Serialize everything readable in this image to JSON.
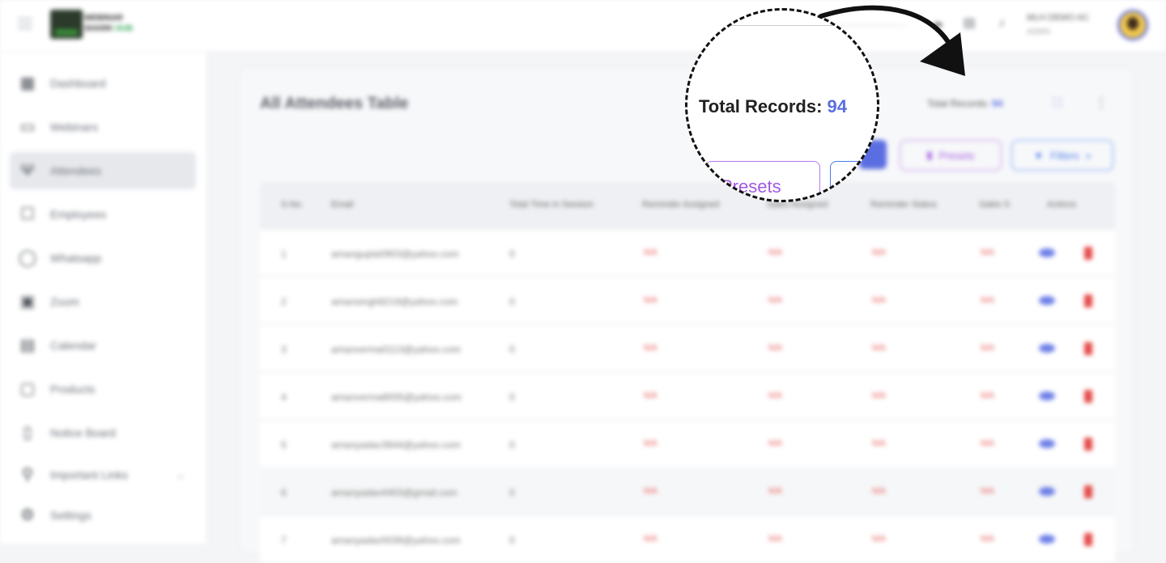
{
  "header": {
    "logo_line1": "WEBINAR",
    "logo_line2a": "SHARK",
    "logo_line2b": "HUB",
    "user_name": "MLH DEMO AC",
    "user_role": "ADMIN"
  },
  "sidebar": {
    "items": [
      {
        "label": "Dashboard",
        "icon": "▦"
      },
      {
        "label": "Webinars",
        "icon": "▭"
      },
      {
        "label": "Attendees",
        "icon": "Ψ"
      },
      {
        "label": "Employees",
        "icon": "☐"
      },
      {
        "label": "Whatsapp",
        "icon": "◯"
      },
      {
        "label": "Zoom",
        "icon": "▣"
      },
      {
        "label": "Calendar",
        "icon": "▤"
      },
      {
        "label": "Products",
        "icon": "▢"
      },
      {
        "label": "Notice Board",
        "icon": "▯"
      },
      {
        "label": "Important Links",
        "icon": "⚲"
      },
      {
        "label": "Settings",
        "icon": "⚙"
      }
    ],
    "chevron": "⌄"
  },
  "main": {
    "title": "All Attendees Table",
    "total_records_label": "Total Records:",
    "total_records_value": "94",
    "presets_label": "Presets",
    "filters_label": "Filters",
    "columns": [
      "S.No.",
      "Email",
      "Total Time in Session",
      "Reminder Assigned",
      "Sales Assigned",
      "Reminder Status",
      "Sales S",
      "Actions"
    ],
    "rows": [
      {
        "sno": "1",
        "email": "amangupta0903@yahoo.com",
        "time": "0",
        "ra": "N/A",
        "sa": "N/A",
        "rs": "N/A",
        "ss": "N/A"
      },
      {
        "sno": "2",
        "email": "amansingh8219@yahoo.com",
        "time": "0",
        "ra": "N/A",
        "sa": "N/A",
        "rs": "N/A",
        "ss": "N/A"
      },
      {
        "sno": "3",
        "email": "amanverma0113@yahoo.com",
        "time": "0",
        "ra": "N/A",
        "sa": "N/A",
        "rs": "N/A",
        "ss": "N/A"
      },
      {
        "sno": "4",
        "email": "amanverma8005@yahoo.com",
        "time": "0",
        "ra": "N/A",
        "sa": "N/A",
        "rs": "N/A",
        "ss": "N/A"
      },
      {
        "sno": "5",
        "email": "amanyadav3844@yahoo.com",
        "time": "0",
        "ra": "N/A",
        "sa": "N/A",
        "rs": "N/A",
        "ss": "N/A"
      },
      {
        "sno": "6",
        "email": "amanyadav4403@gmail.com",
        "time": "0",
        "ra": "N/A",
        "sa": "N/A",
        "rs": "N/A",
        "ss": "N/A"
      },
      {
        "sno": "7",
        "email": "amanyadav0039@yahoo.com",
        "time": "0",
        "ra": "N/A",
        "sa": "N/A",
        "rs": "N/A",
        "ss": "N/A"
      }
    ]
  },
  "magnifier": {
    "records_label": "Total Records:",
    "records_value": "94",
    "presets_fragment": "Presets"
  },
  "colors": {
    "accent": "#5b6ee1",
    "presets": "#a25ae0",
    "danger": "#e54848"
  }
}
